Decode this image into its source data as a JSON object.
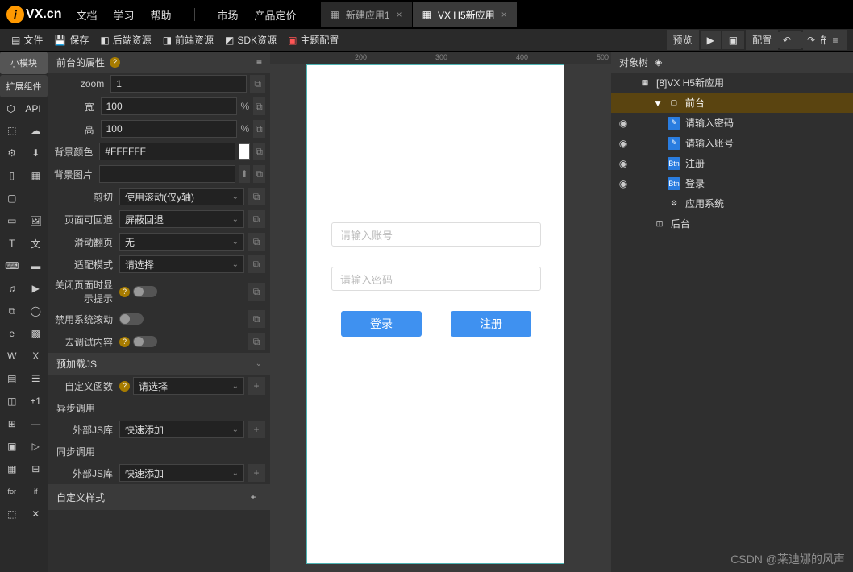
{
  "brand": {
    "logo": "i",
    "name": "VX.cn"
  },
  "top_menu": [
    "文档",
    "学习",
    "帮助",
    "市场",
    "产品定价"
  ],
  "tabs": [
    {
      "label": "新建应用1",
      "active": false
    },
    {
      "label": "VX H5新应用",
      "active": true
    }
  ],
  "toolbar": {
    "items": [
      {
        "label": "文件"
      },
      {
        "label": "保存"
      },
      {
        "label": "后端资源"
      },
      {
        "label": "前端资源"
      },
      {
        "label": "SDK资源"
      },
      {
        "label": "主题配置"
      }
    ],
    "right": {
      "preview": "预览",
      "config": "配置",
      "publish": "发布"
    }
  },
  "left_tabs": {
    "small_module": "小模块",
    "ext_components": "扩展组件",
    "api": "API"
  },
  "props_panel": {
    "title": "前台的属性",
    "zoom": {
      "label": "zoom",
      "value": "1"
    },
    "width": {
      "label": "宽",
      "value": "100",
      "unit": "%"
    },
    "height": {
      "label": "高",
      "value": "100",
      "unit": "%"
    },
    "bg_color": {
      "label": "背景颜色",
      "value": "#FFFFFF"
    },
    "bg_image": {
      "label": "背景图片"
    },
    "clip": {
      "label": "剪切",
      "value": "使用滚动(仅y轴)"
    },
    "page_back": {
      "label": "页面可回退",
      "value": "屏蔽回退"
    },
    "swipe": {
      "label": "滑动翻页",
      "value": "无"
    },
    "adapt": {
      "label": "适配模式",
      "value": "请选择"
    },
    "close_tip": {
      "label": "关闭页面时显示提示"
    },
    "disable_scroll": {
      "label": "禁用系统滚动"
    },
    "debug": {
      "label": "去调试内容"
    },
    "preload_js": "预加载JS",
    "custom_fn": {
      "label": "自定义函数",
      "value": "请选择"
    },
    "async_call": "异步调用",
    "ext_js1": {
      "label": "外部JS库",
      "value": "快速添加"
    },
    "sync_call": "同步调用",
    "ext_js2": {
      "label": "外部JS库",
      "value": "快速添加"
    },
    "custom_style": "自定义样式"
  },
  "ruler_ticks": [
    "200",
    "300",
    "400",
    "500"
  ],
  "canvas": {
    "account_placeholder": "请输入账号",
    "password_placeholder": "请输入密码",
    "login": "登录",
    "register": "注册"
  },
  "tree": {
    "title": "对象树",
    "items": [
      {
        "indent": 0,
        "label": "[8]VX H5新应用",
        "icon": "app",
        "eye": false,
        "expand": ""
      },
      {
        "indent": 1,
        "label": "前台",
        "icon": "screen",
        "eye": false,
        "expand": "▼",
        "selected": true
      },
      {
        "indent": 2,
        "label": "请输入密码",
        "icon": "input",
        "eye": true
      },
      {
        "indent": 2,
        "label": "请输入账号",
        "icon": "input",
        "eye": true
      },
      {
        "indent": 2,
        "label": "注册",
        "icon": "btn",
        "eye": true
      },
      {
        "indent": 2,
        "label": "登录",
        "icon": "btn",
        "eye": true
      },
      {
        "indent": 2,
        "label": "应用系统",
        "icon": "gear",
        "eye": false
      },
      {
        "indent": 1,
        "label": "后台",
        "icon": "server",
        "eye": false
      }
    ]
  },
  "watermark": "CSDN @莱迪娜的风声"
}
